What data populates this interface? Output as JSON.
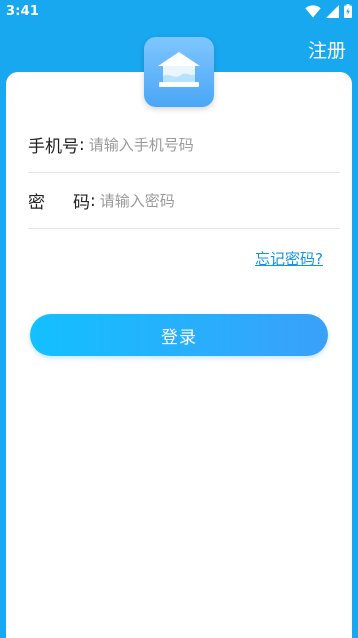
{
  "status_bar": {
    "time": "3:41"
  },
  "header": {
    "register_label": "注册"
  },
  "form": {
    "phone": {
      "label": "手机号",
      "colon": ":",
      "placeholder": "请输入手机号码"
    },
    "password": {
      "label_part1": "密",
      "label_part2": "码",
      "colon": ":",
      "placeholder": "请输入密码"
    },
    "forgot_password": "忘记密码?",
    "login_label": "登录"
  },
  "colors": {
    "background": "#18a8f0",
    "card": "#ffffff",
    "accent_link": "#1593e6",
    "button_gradient_start": "#13c0ff",
    "button_gradient_end": "#3aa0fa"
  },
  "icons": {
    "wifi": "wifi-icon",
    "signal": "signal-icon",
    "battery": "battery-icon",
    "logo": "house-logo-icon"
  }
}
